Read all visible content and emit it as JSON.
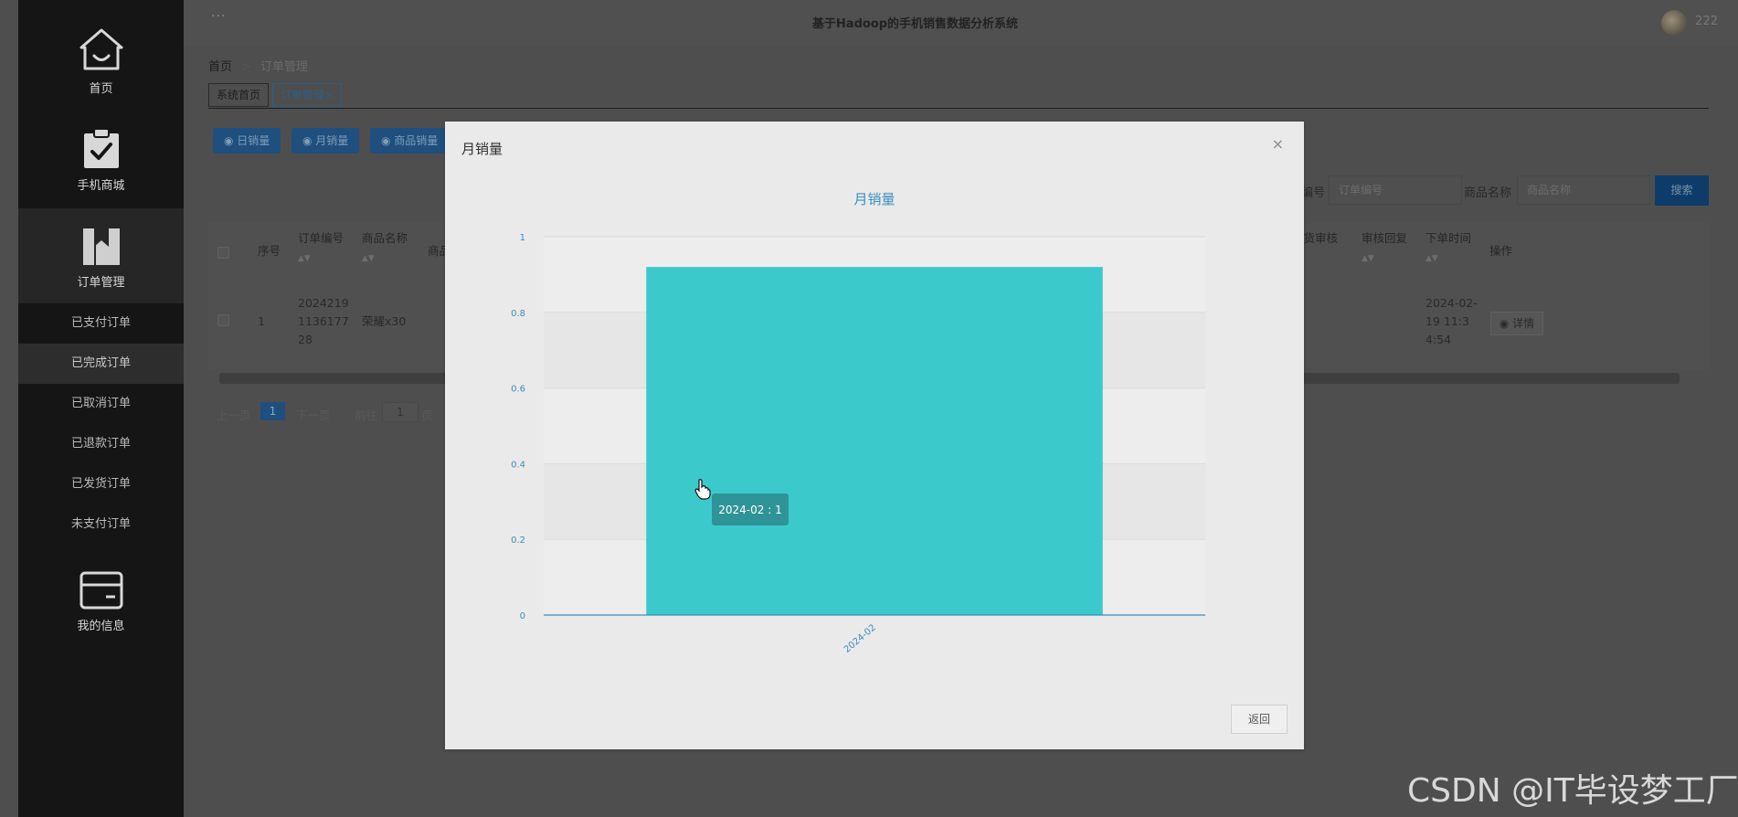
{
  "sidebar": {
    "items": [
      {
        "label": "首页",
        "icon": "home-icon"
      },
      {
        "label": "手机商城",
        "icon": "clipboard-check-icon"
      },
      {
        "label": "订单管理",
        "icon": "book-icon"
      },
      {
        "label": "我的信息",
        "icon": "card-icon"
      }
    ],
    "order_submenu": [
      "已支付订单",
      "已完成订单",
      "已取消订单",
      "已退款订单",
      "已发货订单",
      "未支付订单"
    ]
  },
  "header": {
    "menu_dots": "···",
    "title": "基于Hadoop的手机销售数据分析系统",
    "username": "222"
  },
  "breadcrumb": {
    "home": "首页",
    "current": "订单管理"
  },
  "tabs": [
    {
      "label": "系统首页"
    },
    {
      "label": "订单管理",
      "close": "×"
    }
  ],
  "filter_buttons": [
    "日销量",
    "月销量",
    "商品销量"
  ],
  "search": {
    "order_no_label": "订单编号",
    "order_no_placeholder": "订单编号",
    "product_label": "商品名称",
    "product_placeholder": "商品名称",
    "button": "搜索"
  },
  "table": {
    "columns_left": [
      "序号",
      "订单编号",
      "商品名称",
      "商品"
    ],
    "columns_right": [
      "退货审核",
      "审核回复",
      "下单时间",
      "操作"
    ],
    "row": {
      "index": "1",
      "order_no": "2024219113617728",
      "product": "荣耀x30",
      "time": "2024-02-19 11:34:54",
      "action": "详情"
    }
  },
  "pagination": {
    "prev": "上一页",
    "page": "1",
    "next": "下一页",
    "goto": "前往",
    "goto_value": "1",
    "page_unit": "页"
  },
  "modal": {
    "title": "月销量",
    "close": "×",
    "return_button": "返回",
    "tooltip": "2024-02 : 1"
  },
  "chart_data": {
    "type": "bar",
    "title": "月销量",
    "categories": [
      "2024-02"
    ],
    "values": [
      0.92
    ],
    "ylim": [
      0,
      1
    ],
    "yticks": [
      0,
      0.2,
      0.4,
      0.6,
      0.8,
      1
    ],
    "xlabel": "",
    "ylabel": "",
    "bar_color": "#3cc9cc",
    "accent_color": "#3a8fbf",
    "grid": true
  },
  "watermark": "CSDN @IT毕设梦工厂"
}
